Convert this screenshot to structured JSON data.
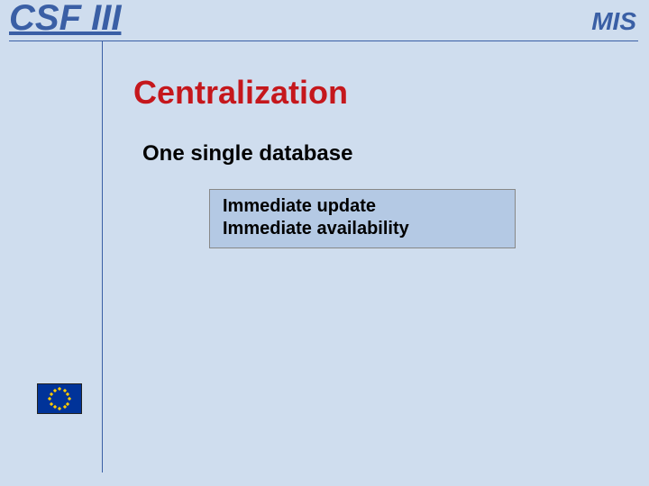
{
  "header": {
    "left": "CSF III",
    "right": "MIS"
  },
  "title": "Centralization",
  "subheading": "One single database",
  "callout": {
    "line1": "Immediate update",
    "line2": "Immediate availability"
  }
}
